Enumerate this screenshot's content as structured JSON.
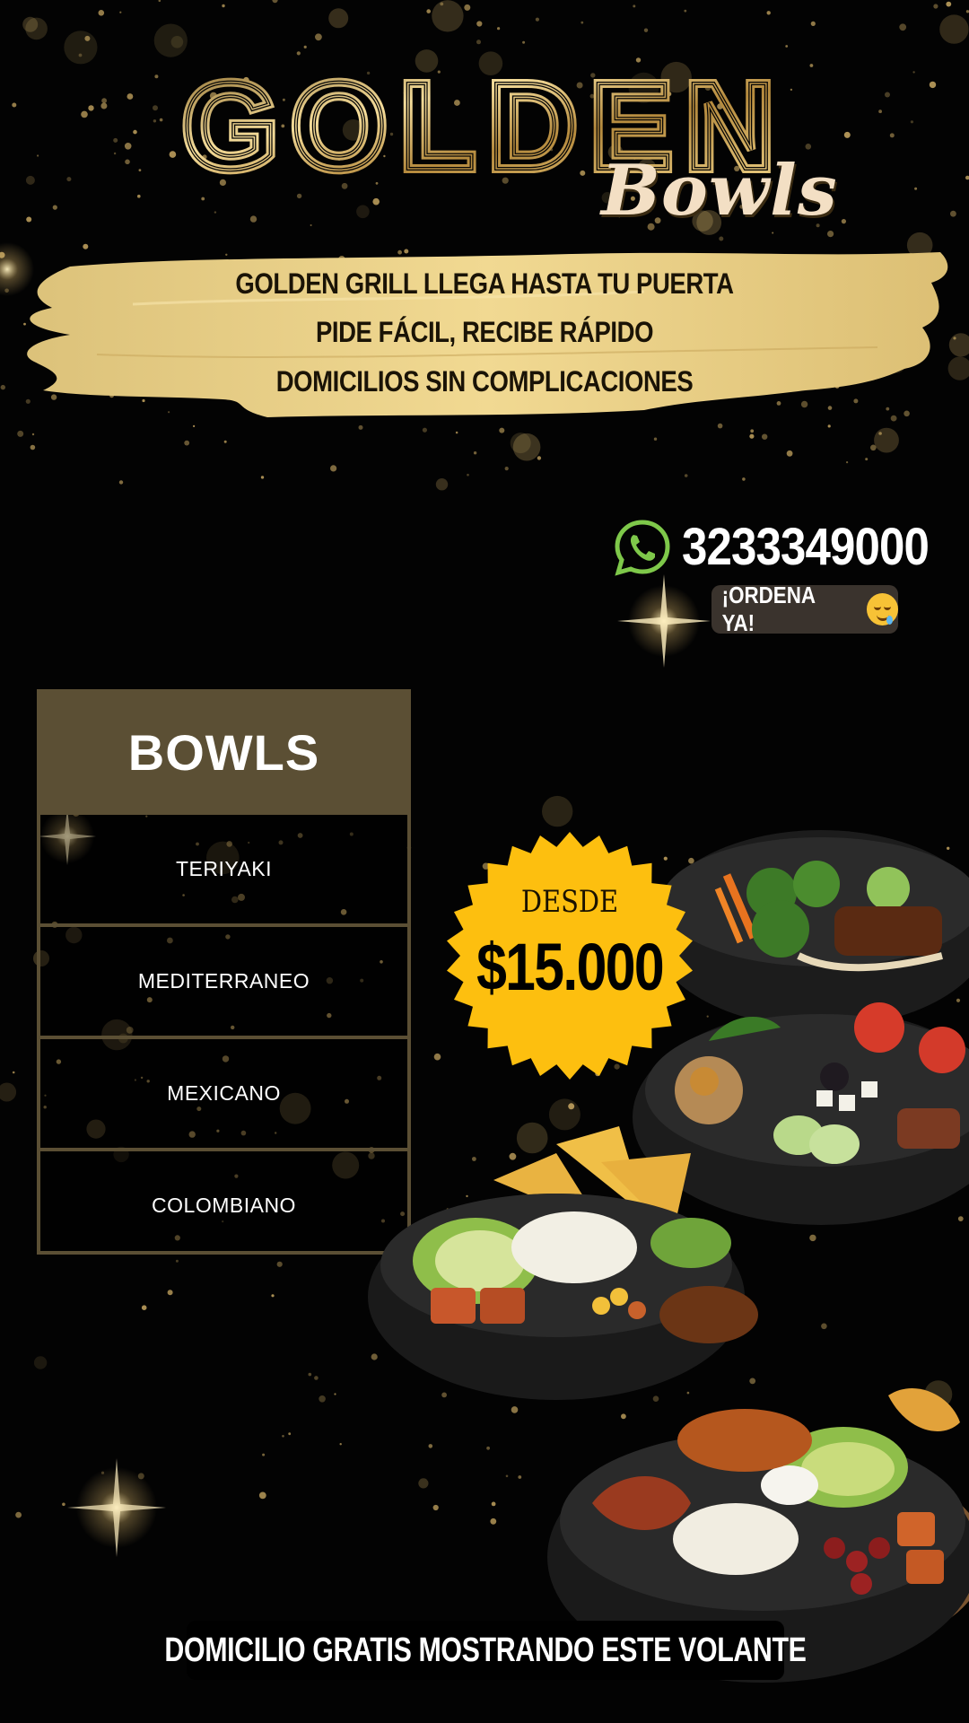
{
  "brand": {
    "name": "GOLDEN",
    "script": "Bowls"
  },
  "taglines": [
    "GOLDEN GRILL LLEGA HASTA TU PUERTA",
    "PIDE FÁCIL, RECIBE RÁPIDO",
    "DOMICILIOS SIN COMPLICACIONES"
  ],
  "contact": {
    "icon": "whatsapp-icon",
    "phone": "3233349000",
    "cta": "¡ORDENA YA!",
    "cta_emoji": "drooling-face-emoji"
  },
  "menu": {
    "title": "BOWLS",
    "items": [
      "TERIYAKI",
      "MEDITERRANEO",
      "MEXICANO",
      "COLOMBIANO"
    ]
  },
  "price_badge": {
    "label": "DESDE",
    "price": "$15.000"
  },
  "footer": {
    "text": "DOMICILIO GRATIS MOSTRANDO ESTE VOLANTE"
  },
  "colors": {
    "background": "#030303",
    "gold": "#d8b56a",
    "brush_gold": "#e9cf84",
    "menu_brown": "#5b4f34",
    "badge_yellow": "#fdbf0f",
    "whatsapp_green": "#7ec84a"
  }
}
